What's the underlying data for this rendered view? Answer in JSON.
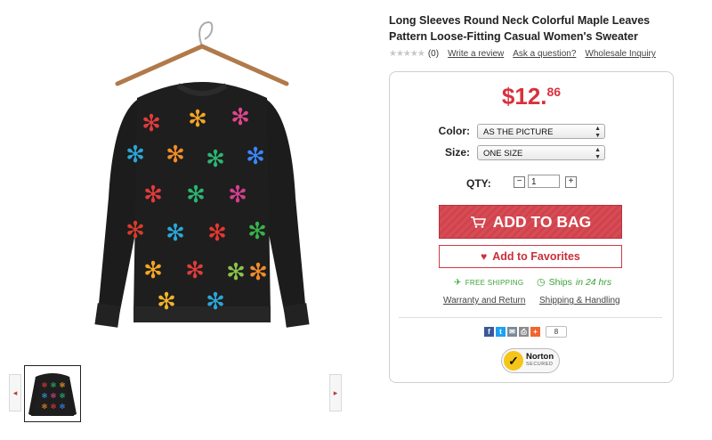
{
  "product": {
    "title": "Long Sleeves Round Neck Colorful Maple Leaves Pattern Loose-Fitting Casual Women's Sweater",
    "stars": "★★★★★",
    "review_count": "(0)",
    "write_review": "Write a review",
    "ask_question": "Ask a question?",
    "wholesale": "Wholesale Inquiry"
  },
  "price": {
    "dollars": "$12.",
    "cents": "86"
  },
  "options": {
    "color_label": "Color:",
    "color_value": "AS THE PICTURE",
    "size_label": "Size:",
    "size_value": "ONE SIZE",
    "qty_label": "QTY:",
    "qty_value": "1",
    "minus": "−",
    "plus": "+"
  },
  "actions": {
    "add_to_bag": "ADD TO BAG",
    "add_to_favorites": "Add to Favorites"
  },
  "shipping": {
    "free_shipping": "FREE SHIPPING",
    "ships_prefix": "Ships",
    "ships_time": "in 24 hrs",
    "warranty": "Warranty and Return",
    "shipping_handling": "Shipping & Handling"
  },
  "share": {
    "count": "8"
  },
  "badge": {
    "norton": "Norton",
    "secured": "SECURED"
  },
  "gallery": {
    "prev": "◂",
    "next": "▸"
  },
  "colors": {
    "accent": "#d2424c",
    "green": "#39a339"
  }
}
